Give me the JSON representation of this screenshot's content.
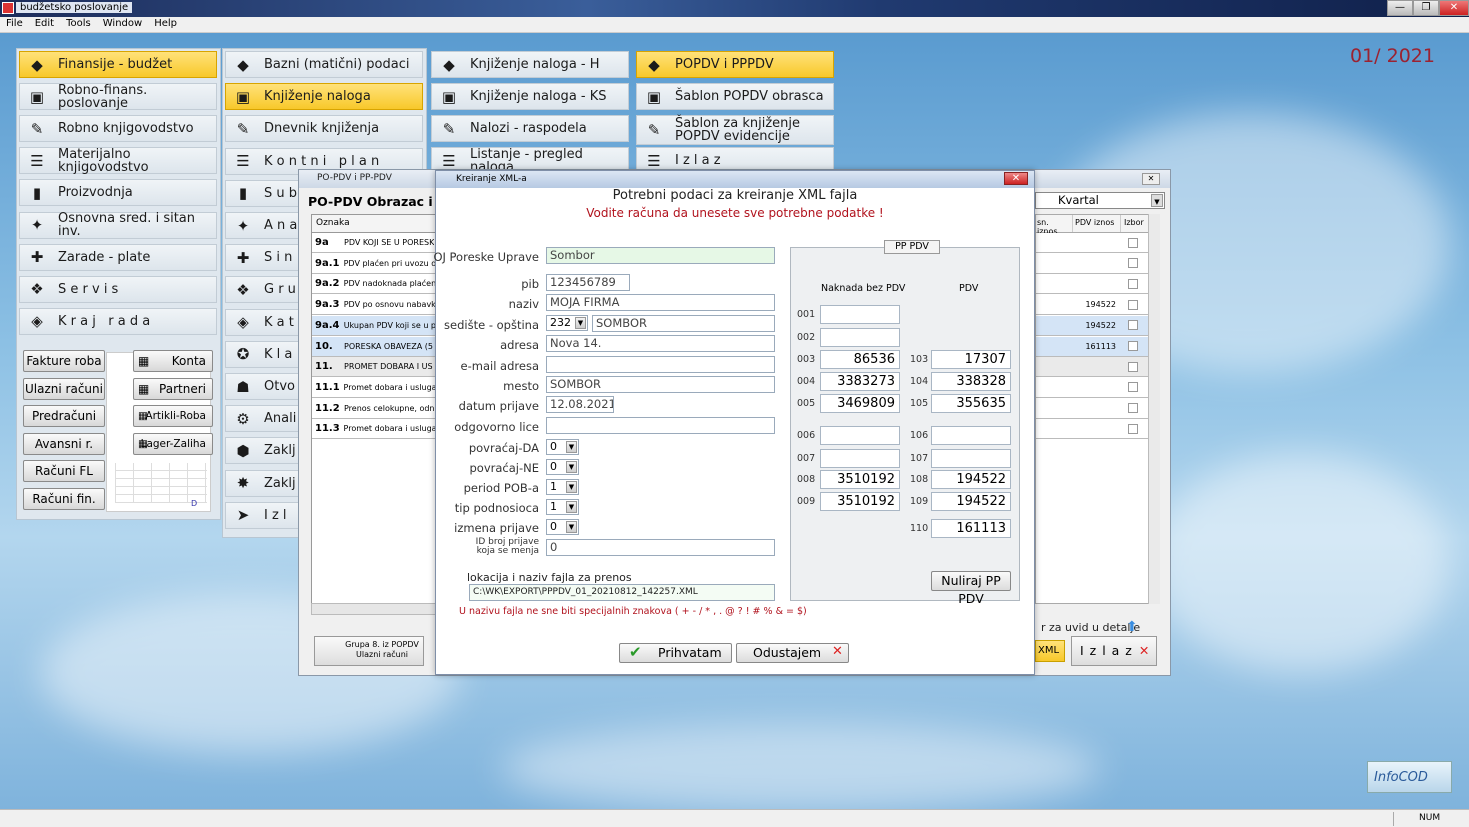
{
  "app": {
    "title": "budžetsko poslovanje",
    "menu": [
      "File",
      "Edit",
      "Tools",
      "Window",
      "Help"
    ],
    "period": "01/ 2021",
    "status_num": "NUM"
  },
  "main_menu": {
    "col1": [
      "Finansije - budžet",
      "Robno-finans. poslovanje",
      "Robno knjigovodstvo",
      "Materijalno knjigovodstvo",
      "Proizvodnja",
      "Osnovna sred. i sitan inv.",
      "Zarade - plate",
      "S e r v i s",
      "K r a j   r a d a"
    ],
    "col2": [
      "Bazni (matični) podaci",
      "Knjiženje naloga",
      "Dnevnik knjiženja",
      "K o n t n i   p l a n",
      "S u b",
      "A n a",
      "S i n",
      "G r u",
      "K a t",
      "K l a",
      "Otvo",
      "Anali",
      "Zaklj",
      "Zaklj",
      "I z l"
    ],
    "col3": [
      "Knjiženje naloga - H",
      "Knjiženje naloga - KS",
      "Nalozi - raspodela",
      "Listanje - pregled naloga"
    ],
    "col4": [
      "POPDV i PPPDV",
      "Šablon POPDV obrasca",
      "Šablon za knjiženje POPDV evidencije",
      "I z l a z"
    ],
    "quick_left": [
      "Fakture roba",
      "Ulazni računi",
      "Predračuni",
      "Avansni r.",
      "Računi FL",
      "Računi fin."
    ],
    "quick_right": [
      "Konta",
      "Partneri",
      "Artikli-Roba",
      "Lager-Zaliha"
    ]
  },
  "popdv_window": {
    "title": "PO-PDV  i  PP-PDV",
    "heading": "PO-PDV Obrazac  i",
    "col_header": "Oznaka",
    "rows": [
      {
        "code": "9a",
        "text": "PDV KOJI SE U PORESK"
      },
      {
        "code": "9a.1",
        "text": "PDV plaćen pri uvozu d"
      },
      {
        "code": "9a.2",
        "text": "PDV nadoknada plaćen"
      },
      {
        "code": "9a.3",
        "text": "PDV po osnovu nabavk"
      },
      {
        "code": "9a.4",
        "text": "Ukupan PDV koji se u p"
      },
      {
        "code": "10.",
        "text": "PORESKA OBAVEZA (5"
      },
      {
        "code": "11.",
        "text": "PROMET DOBARA I US"
      },
      {
        "code": "11.1",
        "text": "Promet dobara i usluga"
      },
      {
        "code": "11.2",
        "text": "Prenos celokupne, odn"
      },
      {
        "code": "11.3",
        "text": "Promet dobara i usluga"
      }
    ],
    "right_header": {
      "kvartal": "Kvartal",
      "c1": "sn. iznos",
      "c2": "PDV iznos",
      "c3": "Izbor"
    },
    "right_values": [
      "",
      "",
      "",
      "194522",
      "194522",
      "161113",
      "",
      "",
      "",
      ""
    ],
    "hint": "r za uvid u detalje",
    "grupa_btn": "Grupa 8. iz POPDV Ulazni računi",
    "xml_btn": "XML",
    "izlaz_btn": "I z l a z"
  },
  "dialog": {
    "title": "Kreiranje XML-a",
    "heading": "Potrebni podaci za kreiranje XML fajla",
    "subheading": "Vodite računa da unesete sve potrebne podatke !",
    "fields": {
      "oj_label": "OJ Poreske Uprave",
      "oj": "Sombor",
      "pib_label": "pib",
      "pib": "123456789",
      "naziv_label": "naziv",
      "naziv": "MOJA FIRMA",
      "sediste_label": "sedište - opština",
      "sediste_code": "232",
      "sediste": "SOMBOR",
      "adresa_label": "adresa",
      "adresa": "Nova 14.",
      "email_label": "e-mail adresa",
      "email": "",
      "mesto_label": "mesto",
      "mesto": "SOMBOR",
      "datum_label": "datum prijave",
      "datum": "12.08.2021",
      "odg_label": "odgovorno lice",
      "odg": "",
      "pov_da_label": "povraćaj-DA",
      "pov_da": "0",
      "pov_ne_label": "povraćaj-NE",
      "pov_ne": "0",
      "period_label": "period POB-a",
      "period": "1",
      "tip_label": "tip podnosioca",
      "tip": "1",
      "izmena_label": "izmena prijave",
      "izmena": "0",
      "id_label1": "ID broj prijave",
      "id_label2": "koja se menja",
      "id": "0"
    },
    "file_label": "lokacija i naziv fajla za prenos",
    "file": "C:\\WK\\EXPORT\\PPPDV_01_20210812_142257.XML",
    "warning": "U nazivu fajla ne sne biti specijalnih znakova ( + - / * , . @ ? ! # % & = $)",
    "pp_pdv": {
      "title": "PP PDV",
      "col1": "Naknada bez PDV",
      "col2": "PDV",
      "left": [
        {
          "code": "001",
          "value": ""
        },
        {
          "code": "002",
          "value": ""
        },
        {
          "code": "003",
          "value": "86536"
        },
        {
          "code": "004",
          "value": "3383273"
        },
        {
          "code": "005",
          "value": "3469809"
        },
        {
          "code": "006",
          "value": ""
        },
        {
          "code": "007",
          "value": ""
        },
        {
          "code": "008",
          "value": "3510192"
        },
        {
          "code": "009",
          "value": "3510192"
        }
      ],
      "right": [
        {
          "code": "103",
          "value": "17307"
        },
        {
          "code": "104",
          "value": "338328"
        },
        {
          "code": "105",
          "value": "355635"
        },
        {
          "code": "106",
          "value": ""
        },
        {
          "code": "107",
          "value": ""
        },
        {
          "code": "108",
          "value": "194522"
        },
        {
          "code": "109",
          "value": "194522"
        },
        {
          "code": "110",
          "value": "161113"
        }
      ],
      "reset": "Nuliraj PP PDV"
    },
    "accept": "Prihvatam",
    "cancel": "Odustajem"
  },
  "logo_text": "InfoCOD"
}
